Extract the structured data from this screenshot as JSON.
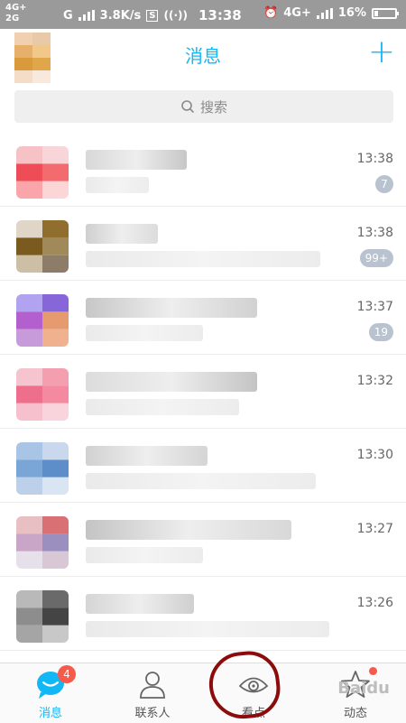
{
  "statusbar": {
    "net_top": "4G+",
    "net_bottom": "2G",
    "carrier": "G",
    "speed": "3.8K/s",
    "time": "13:38",
    "net_right": "4G+",
    "battery": "16%",
    "battery_level": 16
  },
  "header": {
    "title": "消息",
    "plus": "+"
  },
  "search": {
    "placeholder": "搜索"
  },
  "conversations": [
    {
      "time": "13:38",
      "badge": "7",
      "avatar_colors": [
        "#f6c2c6",
        "#f8d5d8",
        "#ee4d57",
        "#f36b6e",
        "#f9a5a9",
        "#fcd6d7"
      ]
    },
    {
      "time": "13:38",
      "badge": "99+",
      "avatar_colors": [
        "#e0d6c8",
        "#8f6e2e",
        "#7a5a1f",
        "#a08a5a",
        "#cdbfa5",
        "#8d7d68"
      ]
    },
    {
      "time": "13:37",
      "badge": "19",
      "avatar_colors": [
        "#b2a3f0",
        "#8666d8",
        "#b35fce",
        "#e59a6f",
        "#c79bd9",
        "#f0b18f"
      ]
    },
    {
      "time": "13:32",
      "badge": "",
      "avatar_colors": [
        "#f5c4cf",
        "#f39fb0",
        "#ee6f8c",
        "#f48aa0",
        "#f7c0cd",
        "#fad4dc"
      ]
    },
    {
      "time": "13:30",
      "badge": "",
      "avatar_colors": [
        "#a9c5e5",
        "#c9d8ec",
        "#7aa6d7",
        "#5d8ec9",
        "#bcd0ea",
        "#d9e5f2"
      ]
    },
    {
      "time": "13:27",
      "badge": "",
      "avatar_colors": [
        "#e8bfc2",
        "#d97074",
        "#c9a6c7",
        "#9b8fc0",
        "#e6e0ea",
        "#d8c7d4"
      ]
    },
    {
      "time": "13:26",
      "badge": "",
      "avatar_colors": [
        "#b9b9b9",
        "#6a6a6a",
        "#8d8d8d",
        "#444444",
        "#a5a5a5",
        "#c8c8c8"
      ]
    }
  ],
  "tabs": [
    {
      "label": "消息",
      "icon": "chat-bubble-icon",
      "badge": "4"
    },
    {
      "label": "联系人",
      "icon": "contacts-icon",
      "badge": ""
    },
    {
      "label": "看点",
      "icon": "eye-icon",
      "badge": ""
    },
    {
      "label": "动态",
      "icon": "star-icon",
      "badge": ""
    }
  ],
  "watermark": "Baidu",
  "colors": {
    "accent": "#12b7f5",
    "badge_red": "#f55a4a",
    "annotation": "#8c0b0b"
  }
}
